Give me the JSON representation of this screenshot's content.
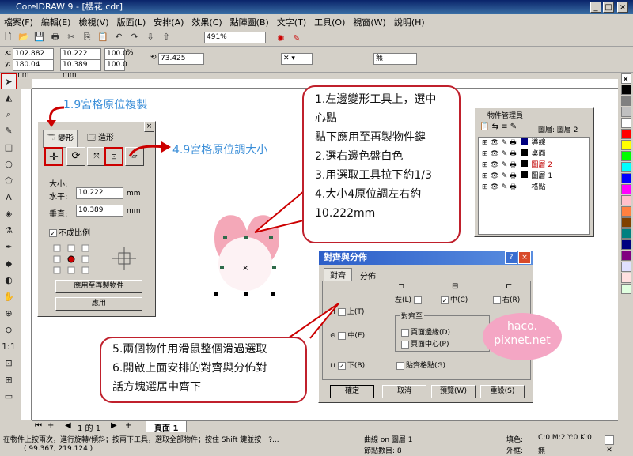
{
  "title": "CorelDRAW 9 - [櫻花.cdr]",
  "menu": [
    "檔案(F)",
    "編輯(E)",
    "檢視(V)",
    "版面(L)",
    "安排(A)",
    "效果(C)",
    "點陣圖(B)",
    "文字(T)",
    "工具(O)",
    "視窗(W)",
    "說明(H)"
  ],
  "toolbar": {
    "zoom": "491%"
  },
  "props": {
    "x": "102.882 mm",
    "y": "180.04 mm",
    "w": "10.222 mm",
    "h": "10.389 mm",
    "sx": "100.0",
    "sy": "100.0",
    "pct": "%",
    "angle": "73.425",
    "outline": "無"
  },
  "docker_transform": {
    "tab1": "變形",
    "tab2": "造形",
    "size_label": "大小:",
    "h_label": "水平:",
    "h_value": "10.222",
    "h_unit": "mm",
    "v_label": "垂直:",
    "v_value": "10.389",
    "v_unit": "mm",
    "proportional": "不成比例",
    "apply_dup": "應用至再製物件",
    "apply": "應用"
  },
  "obj_manager": {
    "title": "物件管理員",
    "layer_label": "圖層: 圖層 2",
    "layers": [
      "導線",
      "桌面",
      "圖層 2",
      "圖層 1",
      "格點"
    ],
    "layer_colors": [
      "#000080",
      "#000000",
      "#c00000",
      "#000000",
      "#000000"
    ]
  },
  "align_dialog": {
    "title": "對齊與分佈",
    "tab1": "對齊",
    "tab2": "分佈",
    "left": "左(L)",
    "center_h": "中(C)",
    "right": "右(R)",
    "top": "上(T)",
    "center_v": "中(E)",
    "bottom": "下(B)",
    "align_to": "對齊至",
    "page_edge": "頁面邊緣(D)",
    "page_center": "頁面中心(P)",
    "snap_grid": "貼齊格點(G)",
    "ok": "確定",
    "cancel": "取消",
    "preview": "預覽(W)",
    "reset": "重設(S)"
  },
  "annotations": {
    "blue1": "1.9宮格原位複製",
    "blue2": "4.9宮格原位調大小",
    "callout1": [
      "1.左邊變形工具上，選中",
      "心點",
      "點下應用至再製物件鍵",
      "2.選右邊色盤白色",
      "3.用選取工具拉下約1/3",
      "4.大小4原位調左右約",
      "10.222mm"
    ],
    "callout2": [
      "5.兩個物件用滑鼠整個滑過選取",
      "6.開啟上面安排的對齊與分佈對",
      "話方塊選居中齊下"
    ],
    "watermark1": "haco.",
    "watermark2": "pixnet.net"
  },
  "pagebar": {
    "pages": "1 的 1",
    "page": "頁面 1"
  },
  "status": {
    "hint": "在物件上按兩次，進行旋轉/傾斜；按兩下工具，選取全部物件；按住 Shift 鍵並按一?...",
    "coords": "( 99.367, 219.124 )",
    "obj": "曲線 on 圖層 1",
    "nodes": "節點數目: 8",
    "fill": "填色:",
    "fill_val": "C:0 M:2 Y:0 K:0",
    "outline": "外框:",
    "outline_val": "無"
  }
}
